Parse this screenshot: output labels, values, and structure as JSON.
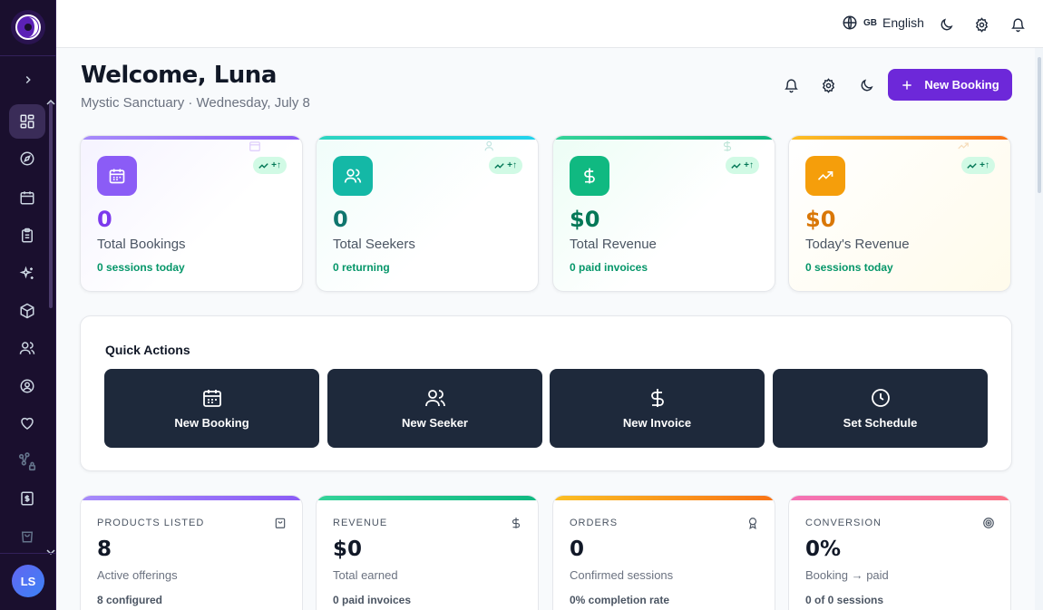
{
  "sidebar": {
    "logo_icon": "moon-logo-icon",
    "items": [
      {
        "name": "dashboard",
        "icon": "grid-icon",
        "active": true
      },
      {
        "name": "explore",
        "icon": "compass-icon"
      },
      {
        "name": "calendar",
        "icon": "calendar-icon"
      },
      {
        "name": "clipboard",
        "icon": "clipboard-icon"
      },
      {
        "name": "sparkles",
        "icon": "sparkles-icon"
      },
      {
        "name": "products",
        "icon": "box-icon"
      },
      {
        "name": "users",
        "icon": "users-icon"
      },
      {
        "name": "profile",
        "icon": "user-circle-icon"
      },
      {
        "name": "favorites",
        "icon": "heart-icon"
      },
      {
        "name": "network",
        "icon": "network-lock-icon"
      },
      {
        "name": "invoices",
        "icon": "dollar-doc-icon"
      },
      {
        "name": "shop",
        "icon": "bag-icon"
      }
    ],
    "avatar_initials": "LS"
  },
  "topbar": {
    "flag": "GB",
    "language": "English"
  },
  "header": {
    "welcome": "Welcome, Luna",
    "subtitle": "Mystic Sanctuary · Wednesday, July 8",
    "new_booking_label": "New Booking"
  },
  "stats": [
    {
      "value": "0",
      "label": "Total Bookings",
      "sub": "0 sessions today",
      "trend": "+↑",
      "accent": "#8b5cf6",
      "icon": "calendar-icon"
    },
    {
      "value": "0",
      "label": "Total Seekers",
      "sub": "0 returning",
      "trend": "+↑",
      "accent": "#14b8a6",
      "icon": "users-icon"
    },
    {
      "value": "$0",
      "label": "Total Revenue",
      "sub": "0 paid invoices",
      "trend": "+↑",
      "accent": "#10b981",
      "icon": "dollar-icon"
    },
    {
      "value": "$0",
      "label": "Today's Revenue",
      "sub": "0 sessions today",
      "trend": "+↑",
      "accent": "#f59e0b",
      "icon": "trending-up-icon"
    }
  ],
  "quick_actions": {
    "title": "Quick Actions",
    "items": [
      {
        "label": "New Booking",
        "icon": "calendar-icon"
      },
      {
        "label": "New Seeker",
        "icon": "users-icon"
      },
      {
        "label": "New Invoice",
        "icon": "dollar-icon"
      },
      {
        "label": "Set Schedule",
        "icon": "clock-icon"
      }
    ]
  },
  "metrics": [
    {
      "caption": "PRODUCTS LISTED",
      "value": "8",
      "desc": "Active offerings",
      "foot": "8 configured",
      "icon": "bag-icon"
    },
    {
      "caption": "REVENUE",
      "value": "$0",
      "desc": "Total earned",
      "foot": "0 paid invoices",
      "icon": "dollar-icon"
    },
    {
      "caption": "ORDERS",
      "value": "0",
      "desc": "Confirmed sessions",
      "foot": "0% completion rate",
      "icon": "award-icon"
    },
    {
      "caption": "CONVERSION",
      "value": "0%",
      "desc": "Booking → paid",
      "foot": "0 of 0 sessions",
      "icon": "target-icon"
    }
  ]
}
